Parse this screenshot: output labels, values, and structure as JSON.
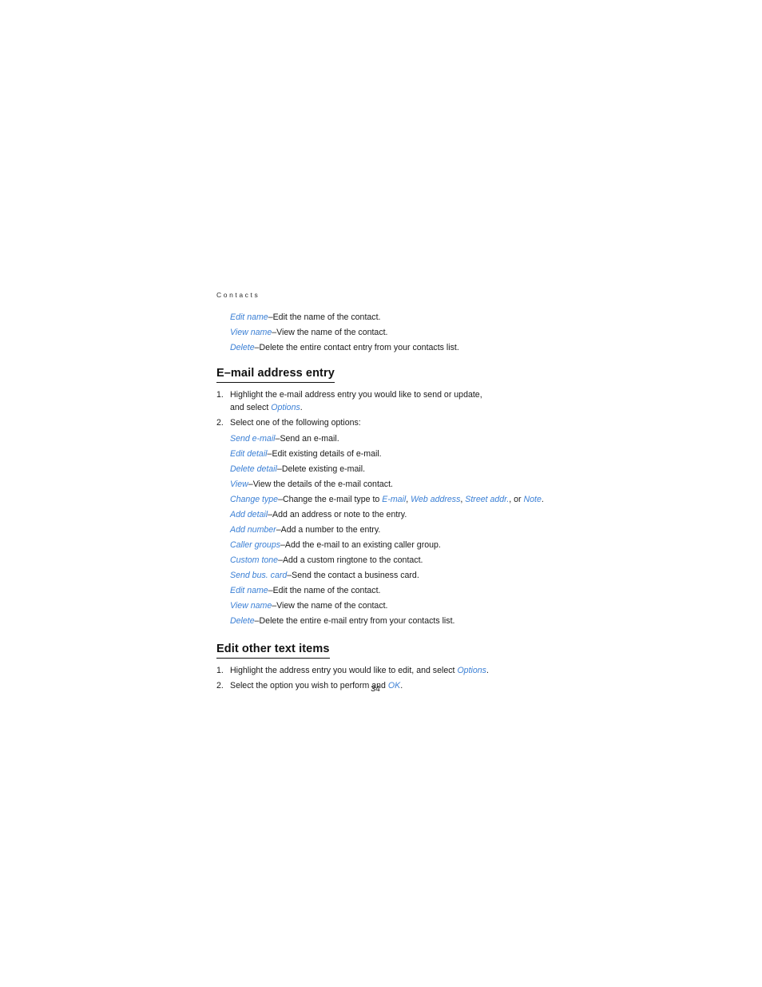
{
  "document": {
    "running_header": "Contacts",
    "page_number": "34"
  },
  "intro_definitions": [
    {
      "term": "Edit name",
      "sep": "–",
      "desc": "Edit the name of the contact."
    },
    {
      "term": "View name",
      "sep": "–",
      "desc": "View the name of the contact."
    },
    {
      "term": "Delete",
      "sep": "–",
      "desc": "Delete the entire contact entry from your contacts list."
    }
  ],
  "section_email": {
    "heading": "E–mail address entry",
    "steps": [
      {
        "number": "1.",
        "line1": "Highlight the e-mail address entry you would like to send or update,",
        "line2_prefix": "and select ",
        "line2_term": "Options",
        "line2_suffix": "."
      },
      {
        "number": "2.",
        "line1": "Select one of the following options:"
      }
    ],
    "definitions": [
      {
        "term": "Send e-mail",
        "sep": "–",
        "desc": "Send an e-mail."
      },
      {
        "term": "Edit detail",
        "sep": "–",
        "desc": "Edit existing details of e-mail."
      },
      {
        "term": "Delete detail",
        "sep": "–",
        "desc": "Delete existing e-mail."
      },
      {
        "term": "View",
        "sep": "–",
        "desc": "View the details of the e-mail contact."
      }
    ],
    "change_type_line": {
      "term": "Change type",
      "sep": "–",
      "desc_prefix": "Change the e-mail type to ",
      "options": [
        "E-mail",
        "Web address",
        "Street addr."
      ],
      "comma": ", ",
      "conjunction": ", or ",
      "last_option": "Note",
      "period": "."
    },
    "definitions_after": [
      {
        "term": "Add detail",
        "sep": "–",
        "desc": "Add an address or note to the entry."
      },
      {
        "term": "Add number",
        "sep": "–",
        "desc": "Add a number to the entry."
      },
      {
        "term": "Caller groups",
        "sep": "–",
        "desc": "Add the e-mail to an existing caller group."
      },
      {
        "term": "Custom tone",
        "sep": "–",
        "desc": "Add a custom ringtone to the contact."
      },
      {
        "term": "Send bus. card",
        "sep": "–",
        "desc": "Send the contact a business card."
      },
      {
        "term": "Edit name",
        "sep": "–",
        "desc": "Edit the name of the contact."
      },
      {
        "term": "View name",
        "sep": "–",
        "desc": "View the name of the contact."
      },
      {
        "term": "Delete",
        "sep": "–",
        "desc": "Delete the entire e-mail entry from your contacts list."
      }
    ]
  },
  "section_other": {
    "heading": "Edit other text items",
    "steps": [
      {
        "number": "1.",
        "prefix": "Highlight the address entry you would like to edit, and select ",
        "term": "Options",
        "suffix": "."
      },
      {
        "number": "2.",
        "prefix": "Select the option you wish to perform and ",
        "term": "OK",
        "suffix": "."
      }
    ]
  },
  "colors": {
    "term_blue": "#3a7fd5",
    "body_text": "#1a1a1a",
    "heading": "#111111",
    "page_background": "#ffffff"
  }
}
